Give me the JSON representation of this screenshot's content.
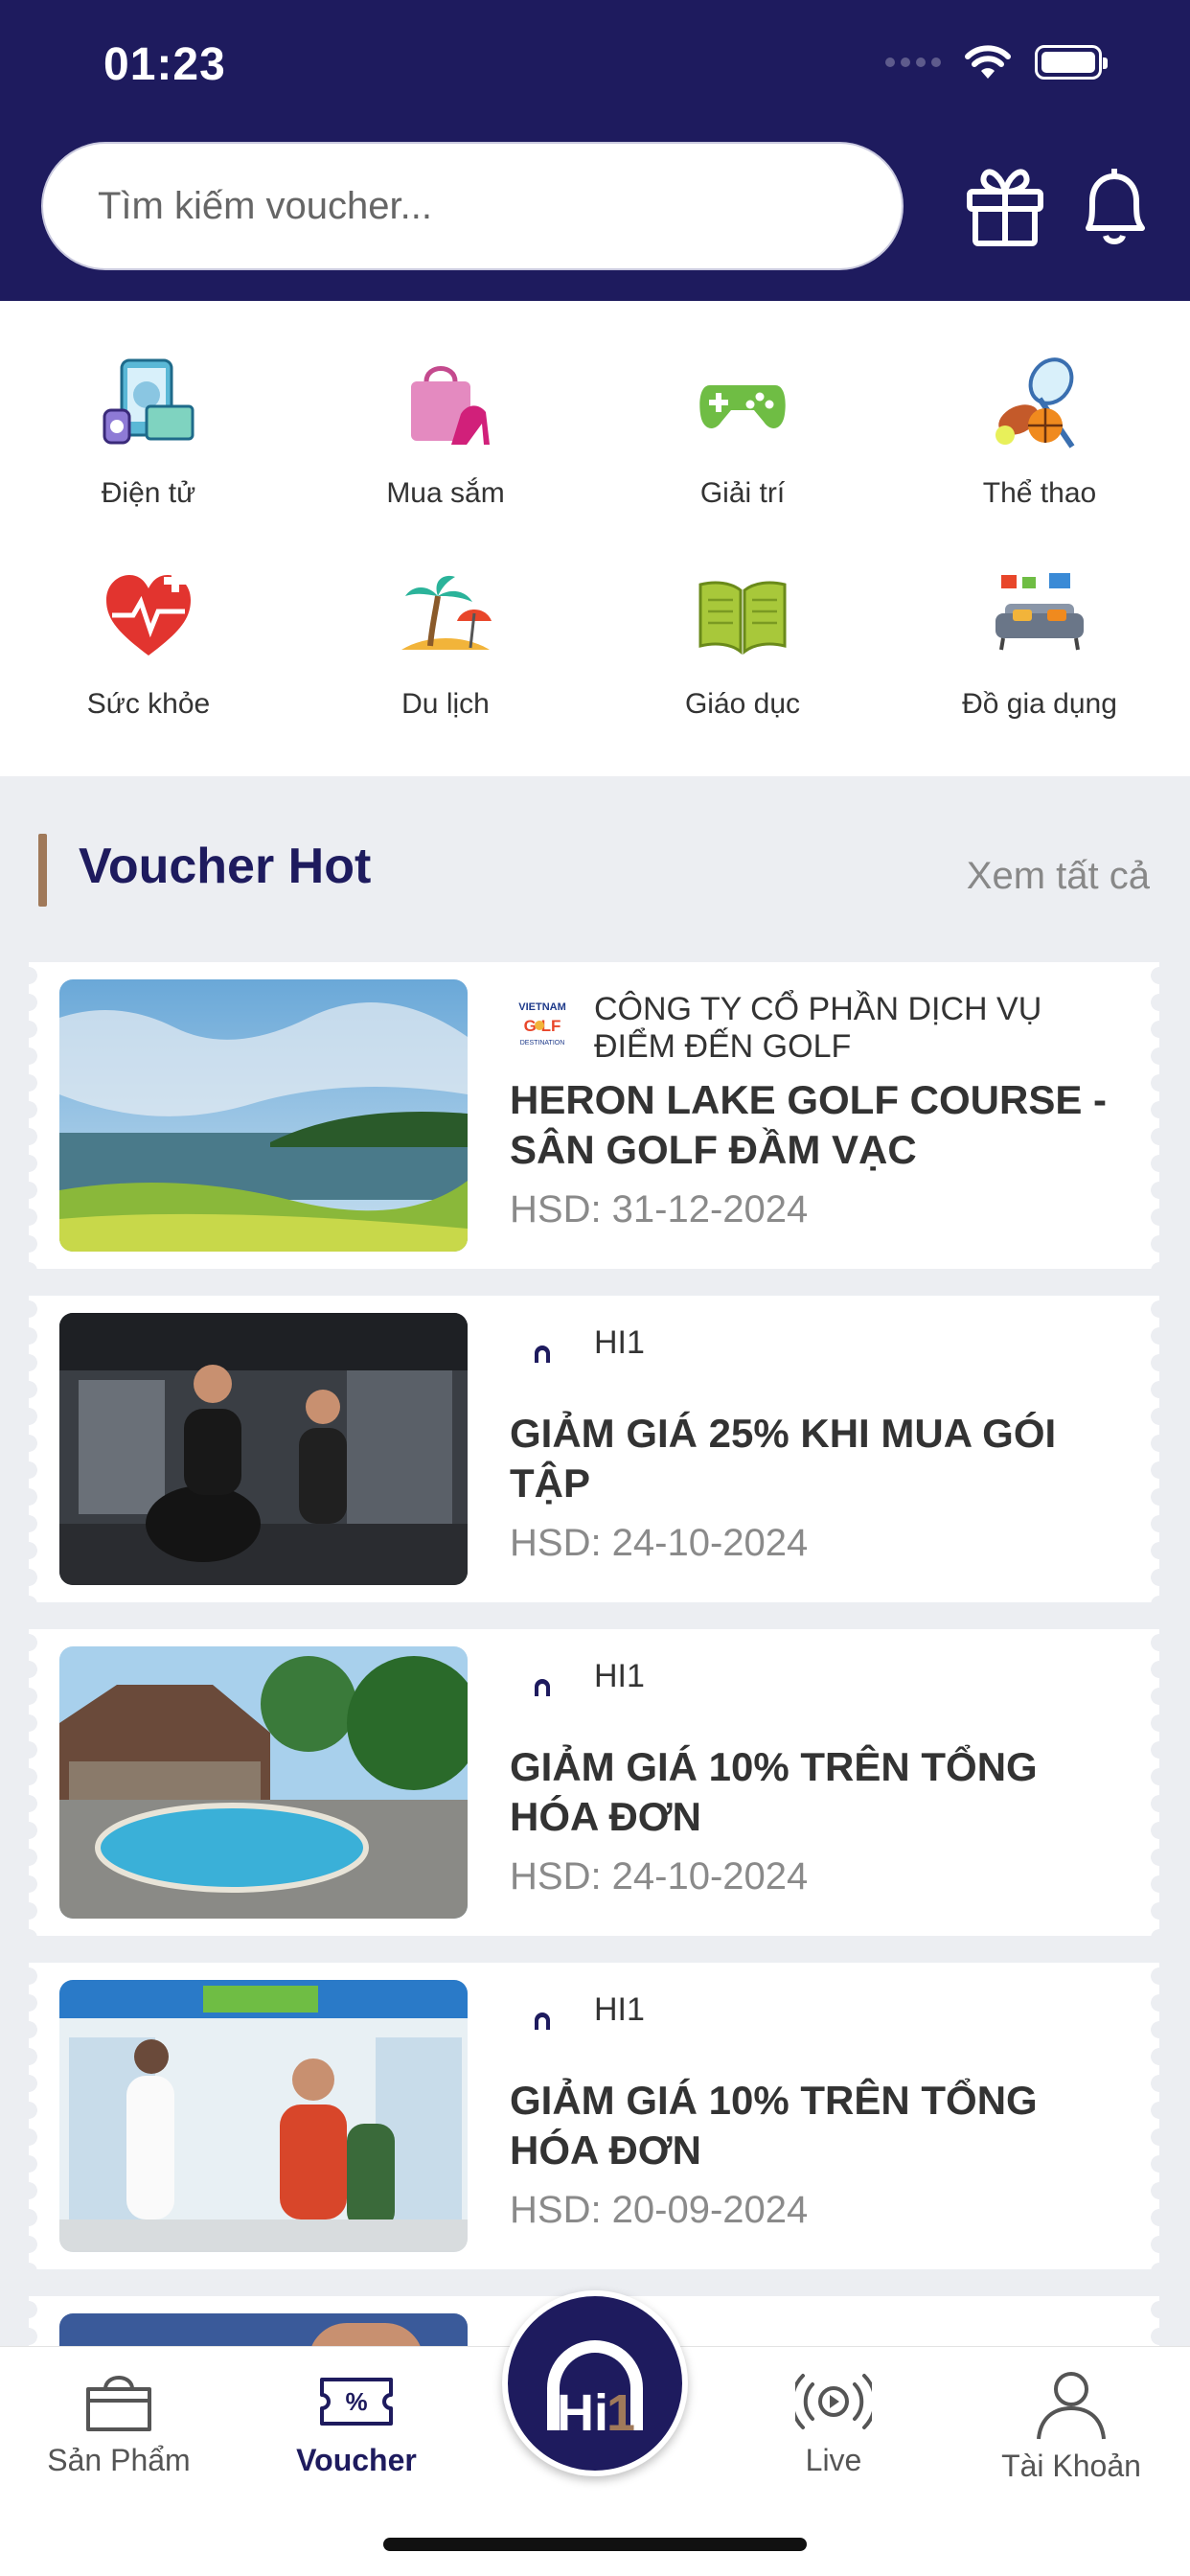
{
  "status_bar": {
    "time": "01:23"
  },
  "header": {
    "search_placeholder": "Tìm kiếm voucher..."
  },
  "categories": [
    {
      "label": "Điện tử",
      "icon": "electronics-icon"
    },
    {
      "label": "Mua sắm",
      "icon": "shopping-bag-icon"
    },
    {
      "label": "Giải trí",
      "icon": "gamepad-icon"
    },
    {
      "label": "Thể thao",
      "icon": "sports-icon"
    },
    {
      "label": "Sức khỏe",
      "icon": "heart-pulse-icon"
    },
    {
      "label": "Du lịch",
      "icon": "beach-icon"
    },
    {
      "label": "Giáo dục",
      "icon": "book-icon"
    },
    {
      "label": "Đồ gia dụng",
      "icon": "sofa-icon"
    }
  ],
  "voucher_hot": {
    "title": "Voucher Hot",
    "see_all": "Xem tất cả",
    "items": [
      {
        "merchant": "CÔNG TY CỔ PHẦN DỊCH VỤ ĐIỂM ĐẾN GOLF",
        "title": "HERON LAKE GOLF COURSE - SÂN GOLF ĐẦM VẠC",
        "expiry": "HSD: 31-12-2024"
      },
      {
        "merchant": "HI1",
        "title": "GIẢM GIÁ 25% KHI MUA GÓI TẬP",
        "expiry": "HSD: 24-10-2024"
      },
      {
        "merchant": "HI1",
        "title": "GIẢM GIÁ 10% TRÊN TỔNG HÓA ĐƠN",
        "expiry": "HSD: 24-10-2024"
      },
      {
        "merchant": "HI1",
        "title": "GIẢM GIÁ 10% TRÊN TỔNG HÓA ĐƠN",
        "expiry": "HSD: 20-09-2024"
      }
    ]
  },
  "tabbar": {
    "items": [
      {
        "label": "Sản Phẩm"
      },
      {
        "label": "Voucher"
      },
      {
        "label": "Live"
      },
      {
        "label": "Tài Khoản"
      }
    ],
    "center_logo": "Hi 1"
  },
  "colors": {
    "brand": "#1e1b5e",
    "accent": "#a0795a"
  }
}
